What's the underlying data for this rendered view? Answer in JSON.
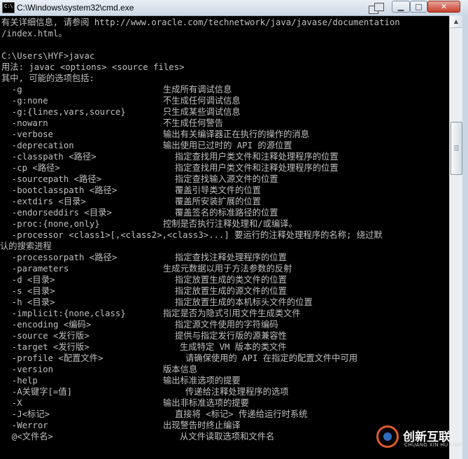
{
  "window": {
    "title": "C:\\Windows\\system32\\cmd.exe",
    "icon": "cmd-icon",
    "icon_text": "C:\\",
    "buttons": {
      "minimize": "▁",
      "maximize": "□",
      "close": "✕"
    }
  },
  "console": {
    "intro": [
      "有关详细信息, 请参阅 http://www.oracle.com/technetwork/java/javase/documentation",
      "/index.html。",
      "",
      "C:\\Users\\HYF>javac",
      "用法: javac <options> <source files>",
      "其中, 可能的选项包括:"
    ],
    "options": [
      {
        "flag": "  -g",
        "desc": "生成所有调试信息"
      },
      {
        "flag": "  -g:none",
        "desc": "不生成任何调试信息"
      },
      {
        "flag": "  -g:{lines,vars,source}",
        "desc": "只生成某些调试信息"
      },
      {
        "flag": "  -nowarn",
        "desc": "不生成任何警告"
      },
      {
        "flag": "  -verbose",
        "desc": "输出有关编译器正在执行的操作的消息"
      },
      {
        "flag": "  -deprecation",
        "desc": "输出使用已过时的 API 的源位置"
      },
      {
        "flag": "  -classpath <路径>",
        "desc": "指定查找用户类文件和注释处理程序的位置"
      },
      {
        "flag": "  -cp <路径>",
        "desc": "指定查找用户类文件和注释处理程序的位置"
      },
      {
        "flag": "  -sourcepath <路径>",
        "desc": "指定查找输入源文件的位置"
      },
      {
        "flag": "  -bootclasspath <路径>",
        "desc": "覆盖引导类文件的位置"
      },
      {
        "flag": "  -extdirs <目录>",
        "desc": "覆盖所安装扩展的位置"
      },
      {
        "flag": "  -endorseddirs <目录>",
        "desc": "覆盖签名的标准路径的位置"
      },
      {
        "flag": "  -proc:{none,only}",
        "desc": "控制是否执行注释处理和/或编译。"
      },
      {
        "flag": "  -processor <class1>[,<class2>,<class3>...] 要运行的注释处理程序的名称; 绕过默",
        "desc": ""
      },
      {
        "flag": "认的搜索进程",
        "desc": ""
      },
      {
        "flag": "  -processorpath <路径>",
        "desc": "指定查找注释处理程序的位置"
      },
      {
        "flag": "  -parameters",
        "desc": "生成元数据以用于方法参数的反射"
      },
      {
        "flag": "  -d <目录>",
        "desc": "指定放置生成的类文件的位置"
      },
      {
        "flag": "  -s <目录>",
        "desc": "指定放置生成的源文件的位置"
      },
      {
        "flag": "  -h <目录>",
        "desc": "指定放置生成的本机标头文件的位置"
      },
      {
        "flag": "  -implicit:{none,class}",
        "desc": "指定是否为隐式引用文件生成类文件"
      },
      {
        "flag": "  -encoding <编码>",
        "desc": "指定源文件使用的字符编码"
      },
      {
        "flag": "  -source <发行版>",
        "desc": "提供与指定发行版的源兼容性"
      },
      {
        "flag": "  -target <发行版>",
        "desc": "生成特定 VM 版本的类文件"
      },
      {
        "flag": "  -profile <配置文件>",
        "desc": "请确保使用的 API 在指定的配置文件中可用"
      },
      {
        "flag": "  -version",
        "desc": "版本信息"
      },
      {
        "flag": "  -help",
        "desc": "输出标准选项的提要"
      },
      {
        "flag": "  -A关键字[=值]",
        "desc": "传递给注释处理程序的选项"
      },
      {
        "flag": "  -X",
        "desc": "输出非标准选项的提要"
      },
      {
        "flag": "  -J<标记>",
        "desc": "直接将 <标记> 传递给运行时系统"
      },
      {
        "flag": "  -Werror",
        "desc": "出现警告时终止编译"
      },
      {
        "flag": "  @<文件名>",
        "desc": "从文件读取选项和文件名"
      }
    ]
  },
  "scrollbar": {
    "up_arrow": "▲"
  },
  "watermark": {
    "cn": "创新互联",
    "en": "CHUANG XIN HU LIAN",
    "logo": "logo-icon"
  },
  "colors": {
    "console_bg": "#000000",
    "console_fg": "#c0c0c0"
  }
}
